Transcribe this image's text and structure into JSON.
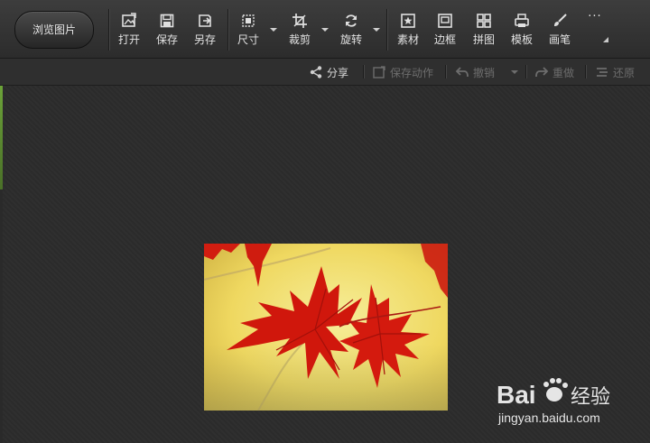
{
  "toolbar": {
    "browse_label": "浏览图片",
    "tools": [
      {
        "name": "open",
        "label": "打开",
        "icon": "open-icon"
      },
      {
        "name": "save",
        "label": "保存",
        "icon": "save-icon"
      },
      {
        "name": "save-as",
        "label": "另存",
        "icon": "save-as-icon"
      },
      {
        "name": "size",
        "label": "尺寸",
        "icon": "resize-icon"
      },
      {
        "name": "crop",
        "label": "裁剪",
        "icon": "crop-icon"
      },
      {
        "name": "rotate",
        "label": "旋转",
        "icon": "rotate-icon"
      },
      {
        "name": "material",
        "label": "素材",
        "icon": "star-icon"
      },
      {
        "name": "border",
        "label": "边框",
        "icon": "frame-icon"
      },
      {
        "name": "collage",
        "label": "拼图",
        "icon": "grid-icon"
      },
      {
        "name": "template",
        "label": "模板",
        "icon": "printer-icon"
      },
      {
        "name": "brush",
        "label": "画笔",
        "icon": "brush-icon"
      },
      {
        "name": "more",
        "label": "···",
        "icon": "more-icon"
      }
    ]
  },
  "actionbar": {
    "share": "分享",
    "save_action": "保存动作",
    "undo": "撤销",
    "redo": "重做",
    "restore": "还原"
  },
  "watermark": {
    "brand": "Bai",
    "brand_suffix": "经验",
    "url": "jingyan.baidu.com"
  },
  "colors": {
    "toolbar_bg": "#353535",
    "canvas_bg": "#2b2b2b",
    "leaf_red": "#d01a10",
    "photo_bg": "#f0d860"
  }
}
